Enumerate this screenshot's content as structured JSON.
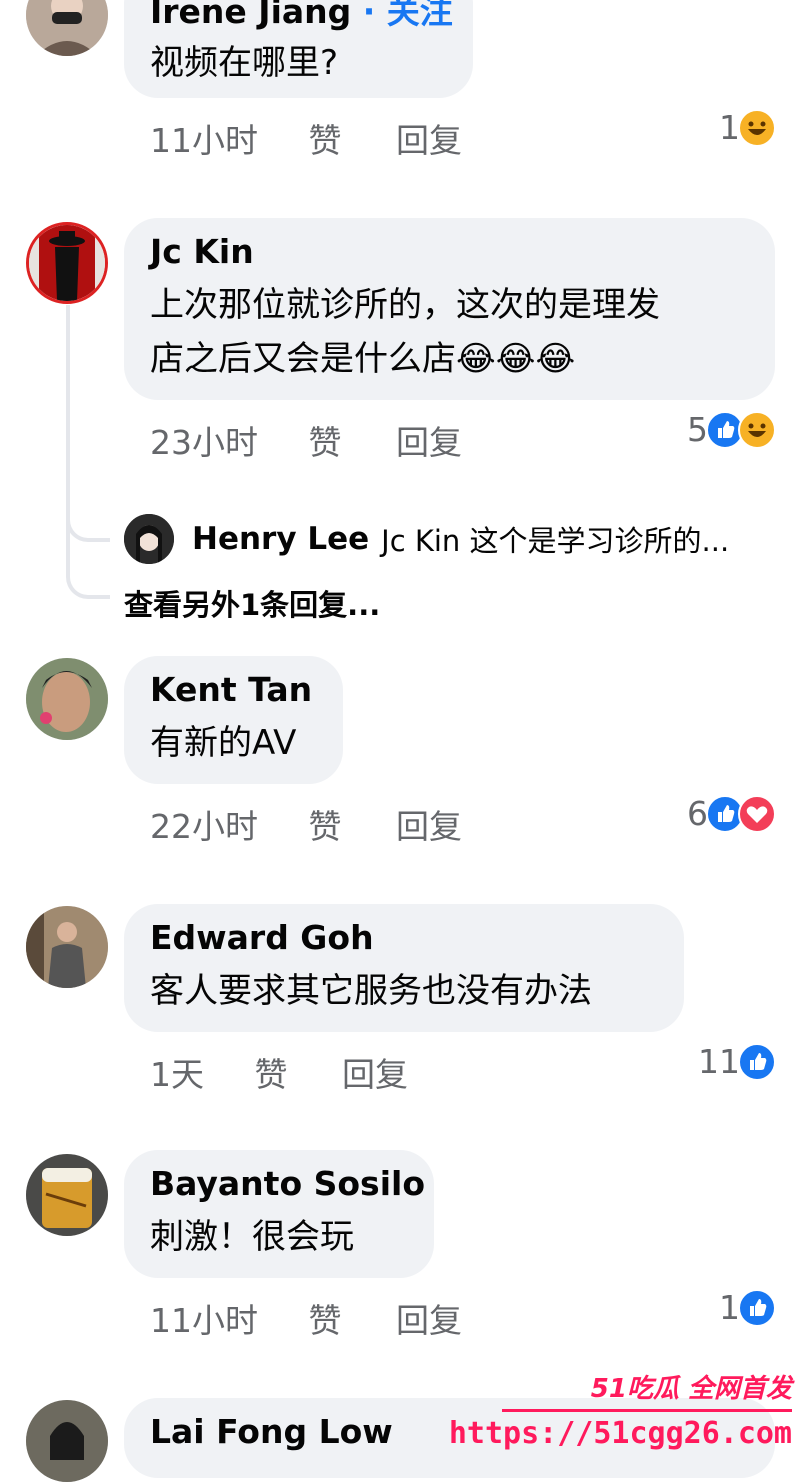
{
  "ui": {
    "like_label": "赞",
    "reply_label": "回复"
  },
  "comments": [
    {
      "author": "Irene Jiang",
      "follow_label": "· 关注",
      "text": "视频在哪里?",
      "time": "11小时",
      "react_count": "1",
      "reactions": [
        "haha"
      ]
    },
    {
      "author": "Jc Kin",
      "text_line1": "上次那位就诊所的，这次的是理发",
      "text_line2": "店之后又会是什么店",
      "text_emoji": "😂😂😂",
      "time": "23小时",
      "react_count": "5",
      "reactions": [
        "like",
        "haha"
      ],
      "reply_preview": {
        "author": "Henry Lee",
        "text": "Jc Kin 这个是学习诊所的..."
      },
      "more_replies": "查看另外1条回复..."
    },
    {
      "author": "Kent Tan",
      "text": "有新的AV",
      "time": "22小时",
      "react_count": "6",
      "reactions": [
        "like",
        "love"
      ]
    },
    {
      "author": "Edward Goh",
      "text": "客人要求其它服务也没有办法",
      "time": "1天",
      "react_count": "11",
      "reactions": [
        "like"
      ]
    },
    {
      "author": "Bayanto Sosilo",
      "text": "刺激！很会玩",
      "time": "11小时",
      "react_count": "1",
      "reactions": [
        "like"
      ]
    },
    {
      "author": "Lai Fong Low"
    }
  ],
  "watermark": {
    "brand": "51吃瓜 全网首发",
    "url": "https://51cgg26.com"
  },
  "colors": {
    "bubble": "#f0f2f5",
    "meta": "#65676b",
    "like": "#1877f2",
    "haha": "#f7b125",
    "love": "#f33e58",
    "follow": "#1877f2",
    "watermark": "#ff1a5c"
  }
}
